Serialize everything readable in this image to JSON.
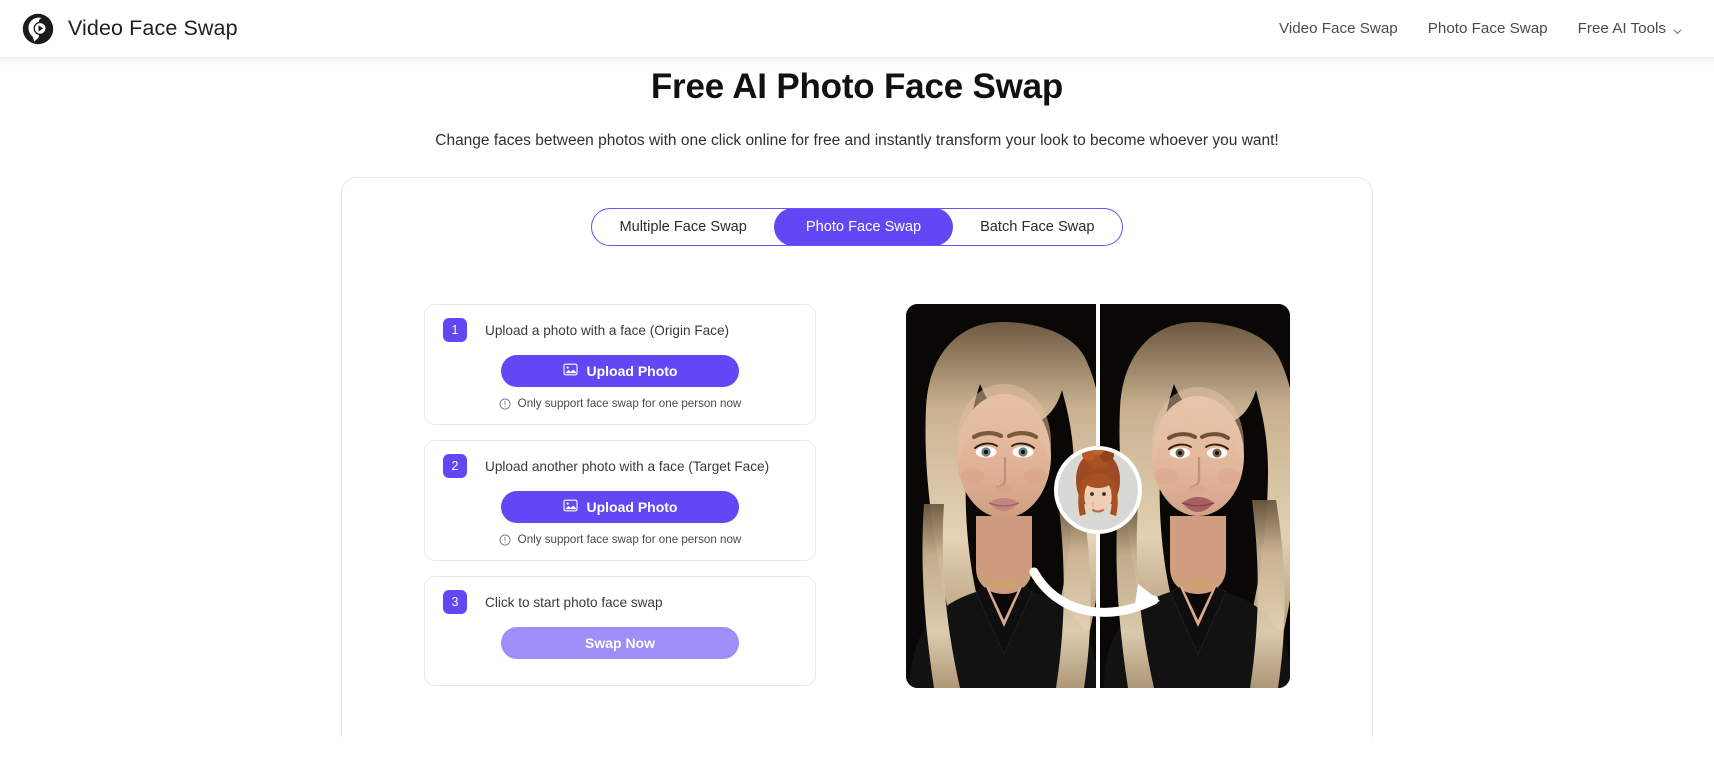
{
  "header": {
    "brand": {
      "logo_icon": "video-face-swap-logo",
      "name": "Video Face Swap"
    },
    "nav": [
      {
        "label": "Video Face Swap",
        "icon": ""
      },
      {
        "label": "Photo Face Swap",
        "icon": ""
      },
      {
        "label": "Free AI Tools",
        "icon": "chevron-down-icon"
      }
    ]
  },
  "hero": {
    "title": "Free AI Photo Face Swap",
    "subtitle": "Change faces between photos with one click online for free and instantly transform your look to become whoever you want!"
  },
  "tabs": [
    {
      "label": "Multiple Face Swap",
      "active": false
    },
    {
      "label": "Photo Face Swap",
      "active": true
    },
    {
      "label": "Batch Face Swap",
      "active": false
    }
  ],
  "steps": [
    {
      "number": "1",
      "label": "Upload a photo with a face",
      "note": "(Origin Face)",
      "button_label": "Upload Photo",
      "button_icon": "image-icon",
      "button_state": "enabled",
      "hint": "Only support face swap for one person now",
      "hint_icon": "info-circle-icon"
    },
    {
      "number": "2",
      "label": "Upload another photo with a face",
      "note": "(Target Face)",
      "button_label": "Upload Photo",
      "button_icon": "image-icon",
      "button_state": "enabled",
      "hint": "Only support face swap for one person now",
      "hint_icon": "info-circle-icon"
    },
    {
      "number": "3",
      "label": "Click to start photo face swap",
      "note": "",
      "button_label": "Swap Now",
      "button_icon": "",
      "button_state": "disabled",
      "hint": "",
      "hint_icon": ""
    }
  ],
  "preview": {
    "name": "face-swap-before-after-preview",
    "description": "Before and after face swap comparison: blonde woman on left, swapped result on right, circular inset of redhead source face in center with curved arrow"
  },
  "colors": {
    "accent": "#6247F5",
    "accent_muted": "#9F8EF7",
    "text": "#1F1F1F",
    "border": "#E8E8EA"
  }
}
